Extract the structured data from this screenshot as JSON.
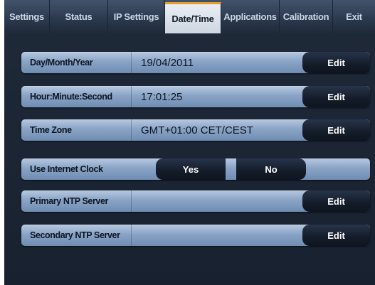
{
  "tabs": [
    {
      "label": "Settings",
      "active": false
    },
    {
      "label": "Status",
      "active": false
    },
    {
      "label": "IP Settings",
      "active": false
    },
    {
      "label": "Date/Time",
      "active": true
    },
    {
      "label": "Applications",
      "active": false
    },
    {
      "label": "Calibration",
      "active": false
    },
    {
      "label": "Exit",
      "active": false
    }
  ],
  "rows": {
    "date": {
      "label": "Day/Month/Year",
      "value": "19/04/2011",
      "button": "Edit"
    },
    "time": {
      "label": "Hour:Minute:Second",
      "value": "17:01:25",
      "button": "Edit"
    },
    "timezone": {
      "label": "Time Zone",
      "value": "GMT+01:00 CET/CEST",
      "button": "Edit"
    },
    "internet_clock": {
      "label": "Use Internet Clock",
      "yes_label": "Yes",
      "no_label": "No"
    },
    "primary_ntp": {
      "label": "Primary NTP Server",
      "value": "",
      "button": "Edit"
    },
    "secondary_ntp": {
      "label": "Secondary NTP Server",
      "value": "",
      "button": "Edit"
    }
  },
  "colors": {
    "active_tab_accent": "#e39c2e",
    "background": "#1f2a3a",
    "row_fill": "#8aa4c6",
    "button_fill": "#141c29"
  }
}
